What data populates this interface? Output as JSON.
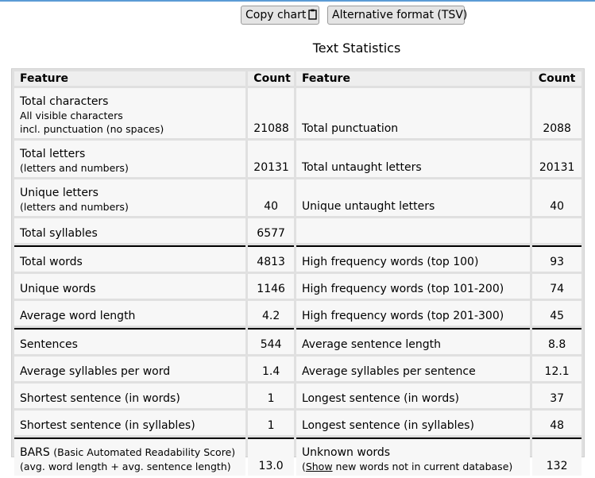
{
  "buttons": {
    "copy_chart": "Copy chart",
    "alternative_format": "Alternative format (TSV)"
  },
  "title": "Text Statistics",
  "headers": {
    "feature": "Feature",
    "count": "Count",
    "feature2": "Feature",
    "count2": "Count"
  },
  "rows": [
    {
      "left_label": "Total characters",
      "left_sub1": "All visible characters",
      "left_sub2": "incl. punctuation (no spaces)",
      "left_value": "21088",
      "right_label": "Total punctuation",
      "right_value": "2088"
    },
    {
      "left_label": "Total letters",
      "left_sub1": "(letters and numbers)",
      "left_value": "20131",
      "right_label": "Total untaught letters",
      "right_value": "20131"
    },
    {
      "left_label": "Unique letters",
      "left_sub1": "(letters and numbers)",
      "left_value": "40",
      "right_label": "Unique untaught letters",
      "right_value": "40"
    },
    {
      "left_label": "Total syllables",
      "left_value": "6577",
      "right_label": "",
      "right_value": ""
    },
    {
      "left_label": "Total words",
      "left_value": "4813",
      "right_label": "High frequency words (top 100)",
      "right_value": "93"
    },
    {
      "left_label": "Unique words",
      "left_value": "1146",
      "right_label": "High frequency words (top 101-200)",
      "right_value": "74"
    },
    {
      "left_label": "Average word length",
      "left_value": "4.2",
      "right_label": "High frequency words (top 201-300)",
      "right_value": "45"
    },
    {
      "left_label": "Sentences",
      "left_value": "544",
      "right_label": "Average sentence length",
      "right_value": "8.8"
    },
    {
      "left_label": "Average syllables per word",
      "left_value": "1.4",
      "right_label": "Average syllables per sentence",
      "right_value": "12.1"
    },
    {
      "left_label": "Shortest sentence (in words)",
      "left_value": "1",
      "right_label": "Longest sentence (in words)",
      "right_value": "37"
    },
    {
      "left_label": "Shortest sentence (in syllables)",
      "left_value": "1",
      "right_label": "Longest sentence (in syllables)",
      "right_value": "48"
    },
    {
      "left_label": "BARS",
      "left_label_paren": "(Basic Automated Readability Score)",
      "left_sub1": "(avg. word length + avg. sentence length)",
      "left_value": "13.0",
      "right_label": "Unknown words",
      "right_sub_open": "(",
      "right_link": "Show",
      "right_sub_rest": " new words not in current database)",
      "right_value": "132"
    }
  ]
}
